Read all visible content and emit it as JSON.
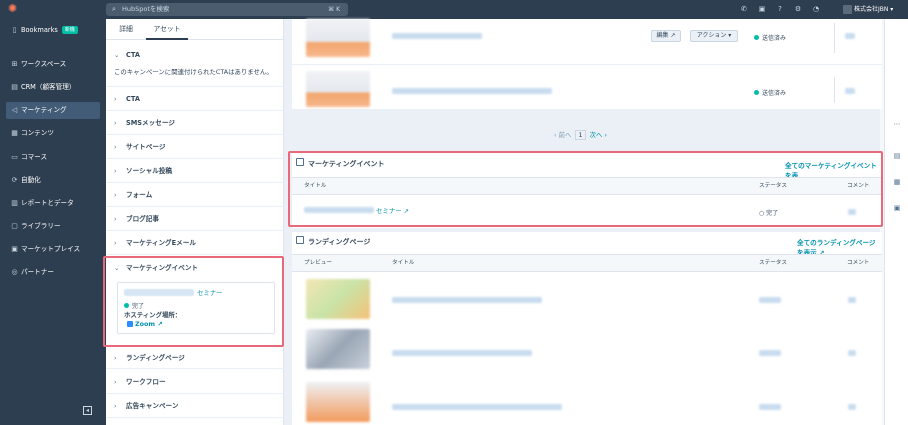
{
  "topbar": {
    "search_placeholder": "HubSpotを検索",
    "search_shortcut": "⌘ K",
    "account_name": "株式会社JBN ▾"
  },
  "nav": {
    "items": [
      {
        "label": "Bookmarks",
        "icon": "bookmark-icon",
        "badge": "新機"
      },
      {
        "label": "ワークスペース",
        "icon": "grid-icon"
      },
      {
        "label": "CRM（顧客管理）",
        "icon": "contacts-icon"
      },
      {
        "label": "マーケティング",
        "icon": "megaphone-icon",
        "active": true
      },
      {
        "label": "コンテンツ",
        "icon": "content-icon"
      },
      {
        "label": "コマース",
        "icon": "commerce-icon"
      },
      {
        "label": "自動化",
        "icon": "automation-icon"
      },
      {
        "label": "レポートとデータ",
        "icon": "reports-icon"
      },
      {
        "label": "ライブラリー",
        "icon": "library-icon"
      },
      {
        "label": "マーケットプレイス",
        "icon": "marketplace-icon"
      },
      {
        "label": "パートナー",
        "icon": "partner-icon"
      }
    ]
  },
  "panel": {
    "tabs": [
      "詳細",
      "アセット"
    ],
    "active_tab": "アセット",
    "cta_open_title": "CTA",
    "cta_empty": "このキャンペーンに関連付けられたCTAはありません。",
    "sections": [
      "CTA",
      "SMSメッセージ",
      "サイトページ",
      "ソーシャル投稿",
      "フォーム",
      "ブログ記事",
      "マーケティングEメール",
      "マーケティングイベント",
      "ランディングページ",
      "ワークフロー",
      "広告キャンペーン"
    ],
    "event_card": {
      "name_suffix": "セミナー",
      "status": "完了",
      "hosting_label": "ホスティング場所：",
      "hosting_value": "Zoom"
    }
  },
  "main": {
    "top_rows": [
      {
        "status": "送信済み",
        "edit_label": "編集",
        "actions_label": "アクション"
      },
      {
        "status": "送信済み"
      }
    ],
    "pager": {
      "prev": "前へ",
      "current": "1",
      "next": "次へ"
    },
    "events": {
      "title": "マーケティングイベント",
      "view_all": "全てのマーケティングイベントを表",
      "columns": {
        "title": "タイトル",
        "status": "ステータス",
        "comment": "コメント"
      },
      "row": {
        "name_suffix": "セミナー",
        "status": "完了"
      }
    },
    "landing": {
      "title": "ランディングページ",
      "view_all": "全てのランディングページを表示",
      "columns": {
        "preview": "プレビュー",
        "title": "タイトル",
        "status": "ステータス",
        "comment": "コメント"
      }
    }
  },
  "colors": {
    "accent": "#0091ae",
    "highlight": "#e8697a",
    "nav_bg": "#2d3e50",
    "brand": "#ff7a59"
  }
}
